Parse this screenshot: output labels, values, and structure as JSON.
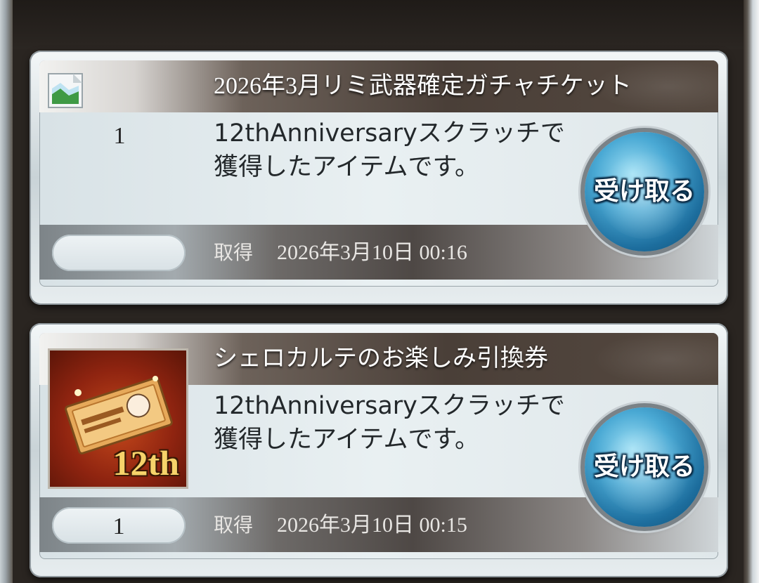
{
  "items": [
    {
      "title": "2026年3月リミ武器確定ガチャチケット",
      "quantity": "1",
      "description": "12thAnniversaryスクラッチで獲得したアイテムです。",
      "acquired_label": "取得",
      "acquired_date": "2026年3月10日 00:16",
      "claim_label": "受け取る",
      "image": "broken-image-icon"
    },
    {
      "title": "シェロカルテのお楽しみ引換券",
      "quantity": "1",
      "description": "12thAnniversaryスクラッチで獲得したアイテムです。",
      "acquired_label": "取得",
      "acquired_date": "2026年3月10日 00:15",
      "claim_label": "受け取る",
      "image": "siero-ticket-icon",
      "image_text": "12th"
    }
  ],
  "colors": {
    "claim_button": "#2a8cc0",
    "title_band": "#4a3f38",
    "background": "#2a2521"
  }
}
